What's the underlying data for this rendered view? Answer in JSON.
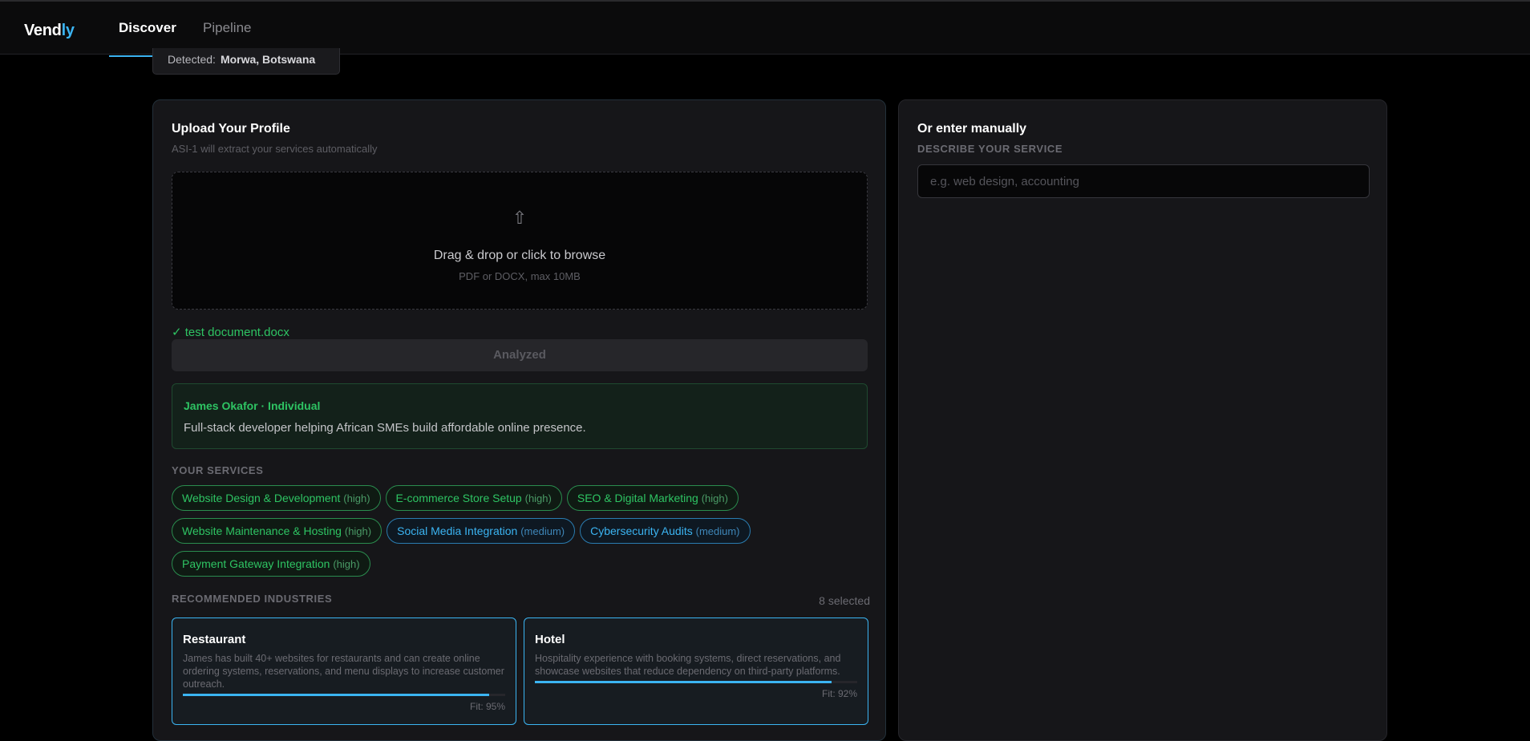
{
  "brand": {
    "name_main": "Vend",
    "name_accent": "ly"
  },
  "nav": {
    "tabs": [
      {
        "label": "Discover"
      },
      {
        "label": "Pipeline"
      }
    ]
  },
  "detected": {
    "label": "Detected:",
    "location": "Morwa, Botswana"
  },
  "upload": {
    "title": "Upload Your Profile",
    "subtitle": "ASI-1 will extract your services automatically",
    "dropzone": {
      "icon": "upload-arrow-icon",
      "glyph": "⇧",
      "title": "Drag & drop or click to browse",
      "hint": "PDF or DOCX, max 10MB"
    },
    "file": {
      "check": "✓",
      "name": "test document.docx"
    },
    "analyze_button": "Analyzed"
  },
  "profile": {
    "name_line": "James Okafor · Individual",
    "description": "Full-stack developer helping African SMEs build affordable online presence."
  },
  "services": {
    "heading": "YOUR SERVICES",
    "items": [
      {
        "name": "Website Design & Development",
        "level": "(high)"
      },
      {
        "name": "E-commerce Store Setup",
        "level": "(high)"
      },
      {
        "name": "SEO & Digital Marketing",
        "level": "(high)"
      },
      {
        "name": "Website Maintenance & Hosting",
        "level": "(high)"
      },
      {
        "name": "Social Media Integration",
        "level": "(medium)"
      },
      {
        "name": "Cybersecurity Audits",
        "level": "(medium)"
      },
      {
        "name": "Payment Gateway Integration",
        "level": "(high)"
      }
    ]
  },
  "industries": {
    "heading": "RECOMMENDED INDUSTRIES",
    "selected_count": "8 selected",
    "cards": [
      {
        "title": "Restaurant",
        "description": "James has built 40+ websites for restaurants and can create online ordering systems, reservations, and menu displays to increase customer outreach.",
        "fit_label": "Fit: 95%",
        "fit_value": 0.95
      },
      {
        "title": "Hotel",
        "description": "Hospitality experience with booking systems, direct reservations, and showcase websites that reduce dependency on third-party platforms.",
        "fit_label": "Fit: 92%",
        "fit_value": 0.92
      }
    ]
  },
  "manual": {
    "title": "Or enter manually",
    "label": "DESCRIBE YOUR SERVICE",
    "placeholder": "e.g. web design, accounting",
    "value": ""
  },
  "colors": {
    "accent": "#3bb4f2",
    "success": "#2ec463",
    "background": "#000000",
    "panel": "#161619"
  }
}
